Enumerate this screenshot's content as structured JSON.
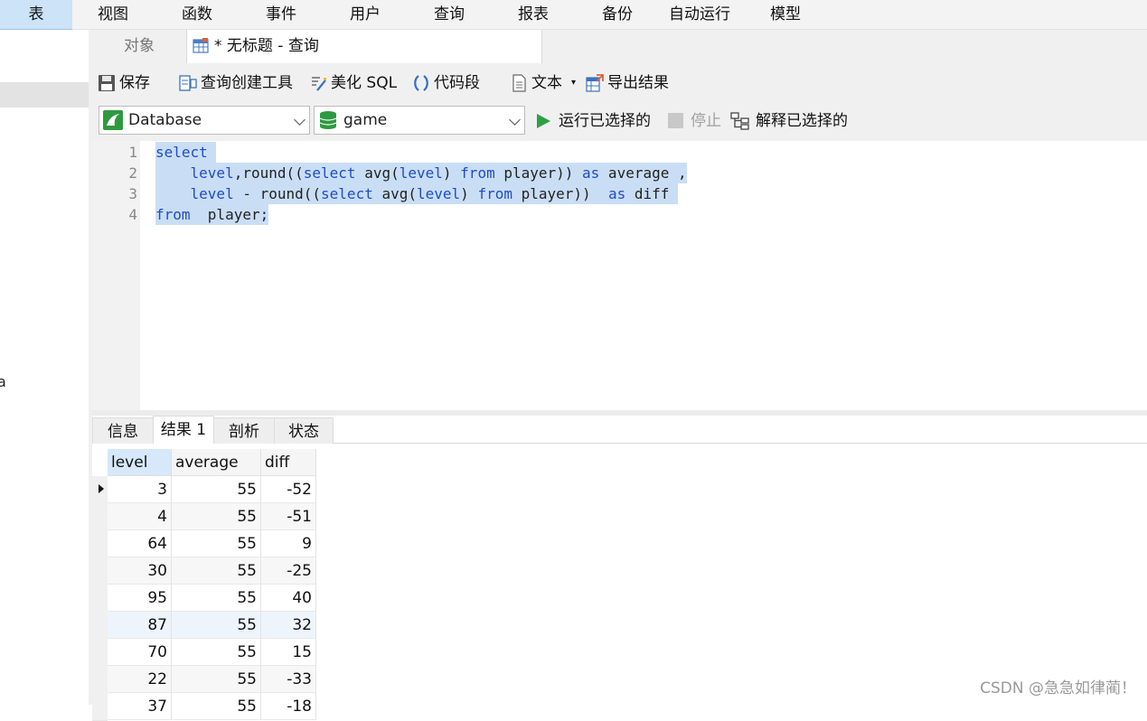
{
  "menubar": {
    "items": [
      "表",
      "视图",
      "函数",
      "事件",
      "用户",
      "查询",
      "报表",
      "备份",
      "自动运行",
      "模型"
    ]
  },
  "leftpanel": {
    "stray_text": "a"
  },
  "tabs": {
    "objects": "对象",
    "query": "* 无标题 - 查询"
  },
  "toolbar": {
    "save": "保存",
    "query_builder": "查询创建工具",
    "beautify": "美化 SQL",
    "snippet": "代码段",
    "text": "文本",
    "text_dropdown": "▾",
    "export": "导出结果"
  },
  "selectors": {
    "connection": "Database",
    "database": "game",
    "run_selected": "运行已选择的",
    "stop": "停止",
    "explain_selected": "解释已选择的"
  },
  "editor": {
    "line_numbers": [
      "1",
      "2",
      "3",
      "4"
    ],
    "lines": [
      "select ",
      "    level,round((select avg(level) from player)) as average ,",
      "    level - round((select avg(level) from player))  as diff ",
      "from  player;"
    ]
  },
  "result_tabs": [
    "信息",
    "结果 1",
    "剖析",
    "状态"
  ],
  "grid": {
    "columns": [
      "level",
      "average",
      "diff"
    ],
    "rows": [
      [
        "3",
        "55",
        "-52"
      ],
      [
        "4",
        "55",
        "-51"
      ],
      [
        "64",
        "55",
        "9"
      ],
      [
        "30",
        "55",
        "-25"
      ],
      [
        "95",
        "55",
        "40"
      ],
      [
        "87",
        "55",
        "32"
      ],
      [
        "70",
        "55",
        "15"
      ],
      [
        "22",
        "55",
        "-33"
      ],
      [
        "37",
        "55",
        "-18"
      ]
    ]
  },
  "watermark": "CSDN @急急如律蔺！",
  "colors": {
    "selection": "#c9def5",
    "keyword": "#1f4cc7",
    "run_green": "#2ea043",
    "menu_active": "#cde3f7"
  }
}
